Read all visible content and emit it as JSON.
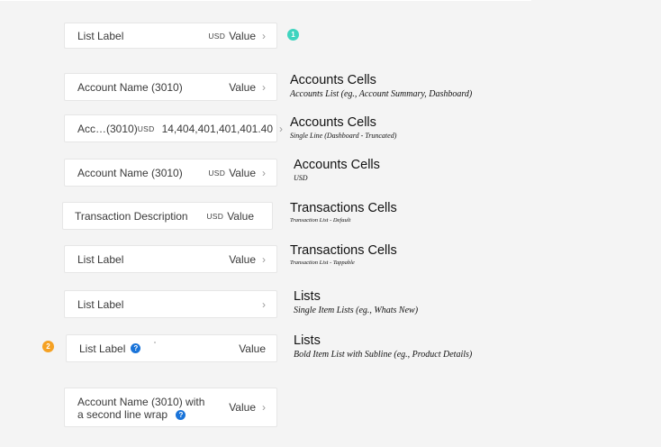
{
  "colors": {
    "badge_1": "#3fd4bf",
    "badge_2": "#f5a123",
    "help_icon": "#1a74d9",
    "background": "#f4f4f4"
  },
  "badges": {
    "one": "1",
    "two": "2"
  },
  "help_icon_glyph": "?",
  "chevron_glyph": "›",
  "cells": {
    "list_label_usd": {
      "label": "List Label",
      "currency": "USD",
      "value": "Value"
    },
    "account_name": {
      "label": "Account Name (3010)",
      "value": "Value"
    },
    "account_truncated": {
      "label": "Acc…(3010)",
      "currency": "USD",
      "value": "14,404,401,401,401.40"
    },
    "account_name_usd": {
      "label": "Account Name (3010)",
      "currency": "USD",
      "value": "Value"
    },
    "transaction": {
      "label": "Transaction Description",
      "currency": "USD",
      "value": "Value"
    },
    "list_label_value": {
      "label": "List Label",
      "value": "Value"
    },
    "list_label_single": {
      "label": "List Label"
    },
    "list_label_bold": {
      "label": "List Label",
      "value": "Value"
    },
    "account_wrap": {
      "label_line1": "Account Name (3010) with",
      "label_line2": "a second line wrap",
      "value": "Value"
    }
  },
  "descriptions": [
    {
      "title": "Accounts Cells",
      "subtitle": "Accounts List (eg., Account Summary, Dashboard)"
    },
    {
      "title": "Accounts Cells",
      "subtitle": "Single Line (Dashboard - Truncated)"
    },
    {
      "title": "Accounts Cells",
      "subtitle": "USD"
    },
    {
      "title": "Transactions Cells",
      "subtitle": "Transaction List - Default"
    },
    {
      "title": "Transactions Cells",
      "subtitle": "Transaction List - Tappable"
    },
    {
      "title": "Lists",
      "subtitle": "Single Item Lists (eg., Whats New)"
    },
    {
      "title": "Lists",
      "subtitle": "Bold Item List with Subline (eg., Product Details)"
    }
  ]
}
